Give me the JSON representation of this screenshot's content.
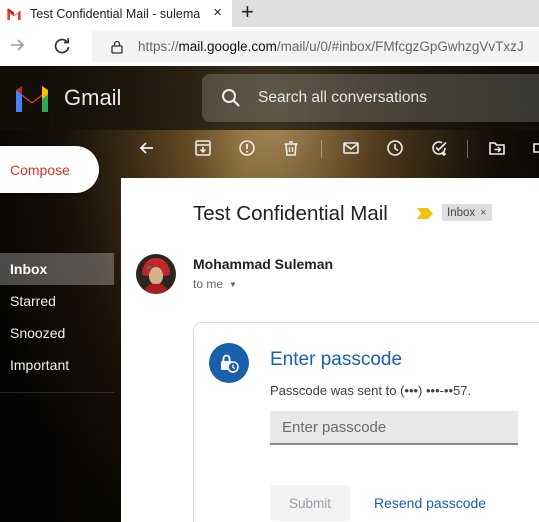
{
  "browser": {
    "tab_title": "Test Confidential Mail - suleman",
    "tab_close": "×",
    "new_tab": "+",
    "url_prefix": "https://",
    "url_domain": "mail.google.com",
    "url_path": "/mail/u/0/#inbox/FMfcgzGpGwhzgVvTxzJ"
  },
  "header": {
    "app_name": "Gmail",
    "search_placeholder": "Search all conversations"
  },
  "sidebar": {
    "compose_label": "Compose",
    "items": [
      {
        "label": "Inbox",
        "active": true
      },
      {
        "label": "Starred"
      },
      {
        "label": "Snoozed"
      },
      {
        "label": "Important"
      }
    ]
  },
  "message": {
    "subject": "Test Confidential Mail",
    "label_chip": "Inbox",
    "label_remove": "×",
    "sender": "Mohammad Suleman",
    "recipient": "to me",
    "recipient_caret": "▼"
  },
  "passcode": {
    "title": "Enter passcode",
    "note": "Passcode was sent to (•••) •••-••57.",
    "input_placeholder": "Enter passcode",
    "submit_label": "Submit",
    "resend_label": "Resend passcode"
  },
  "colors": {
    "brand_blue": "#1a5fab",
    "compose_red": "#d93025",
    "important_yellow": "#f4c20d"
  }
}
